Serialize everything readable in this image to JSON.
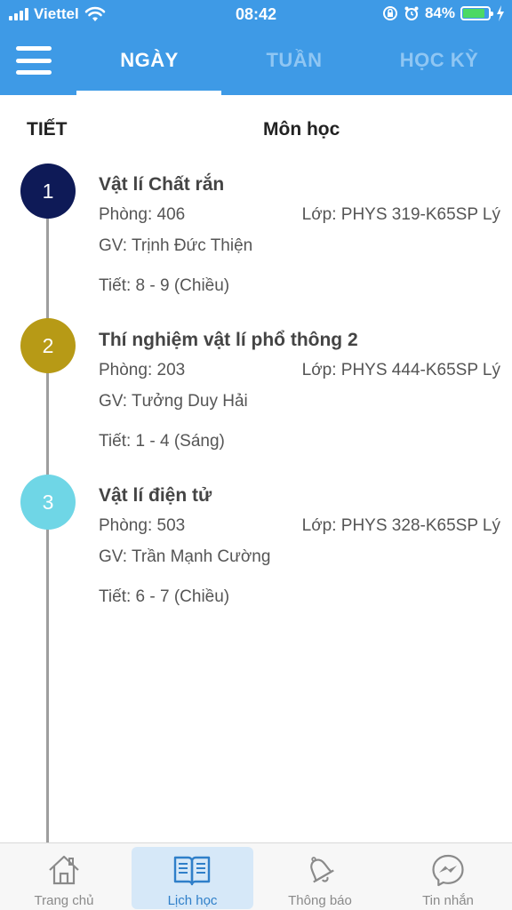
{
  "status_bar": {
    "carrier": "Viettel",
    "time": "08:42",
    "battery_percent": "84%",
    "battery_level": 0.84
  },
  "header": {
    "menu_icon": "hamburger-menu-icon",
    "tabs": [
      {
        "label": "NGÀY",
        "active": true
      },
      {
        "label": "TUẦN",
        "active": false
      },
      {
        "label": "HỌC KỲ",
        "active": false
      }
    ],
    "colors": {
      "background": "#3e9ae6",
      "active": "#ffffff",
      "inactive": "#8fc6f3"
    }
  },
  "columns": {
    "period": "TIẾT",
    "subject": "Môn học"
  },
  "schedule": [
    {
      "index": "1",
      "color": "#0e1a57",
      "subject": "Vật lí Chất rắn",
      "room": "Phòng: 406",
      "class": "Lớp: PHYS 319-K65SP Lý",
      "teacher": "GV: Trịnh Đức Thiện",
      "period": "Tiết: 8 - 9 (Chiều)"
    },
    {
      "index": "2",
      "color": "#b79a16",
      "subject": "Thí nghiệm vật lí phổ thông 2",
      "room": "Phòng: 203",
      "class": "Lớp: PHYS 444-K65SP Lý",
      "teacher": "GV: Tưởng Duy Hải",
      "period": "Tiết: 1 - 4 (Sáng)"
    },
    {
      "index": "3",
      "color": "#6fd6e6",
      "subject": "Vật lí điện tử",
      "room": "Phòng: 503",
      "class": "Lớp: PHYS 328-K65SP Lý",
      "teacher": "GV: Trần Mạnh Cường",
      "period": "Tiết: 6 - 7 (Chiều)"
    }
  ],
  "bottom_nav": [
    {
      "label": "Trang chủ",
      "icon": "home-icon",
      "active": false
    },
    {
      "label": "Lịch học",
      "icon": "book-icon",
      "active": true
    },
    {
      "label": "Thông báo",
      "icon": "bell-icon",
      "active": false
    },
    {
      "label": "Tin nhắn",
      "icon": "messenger-icon",
      "active": false
    }
  ]
}
